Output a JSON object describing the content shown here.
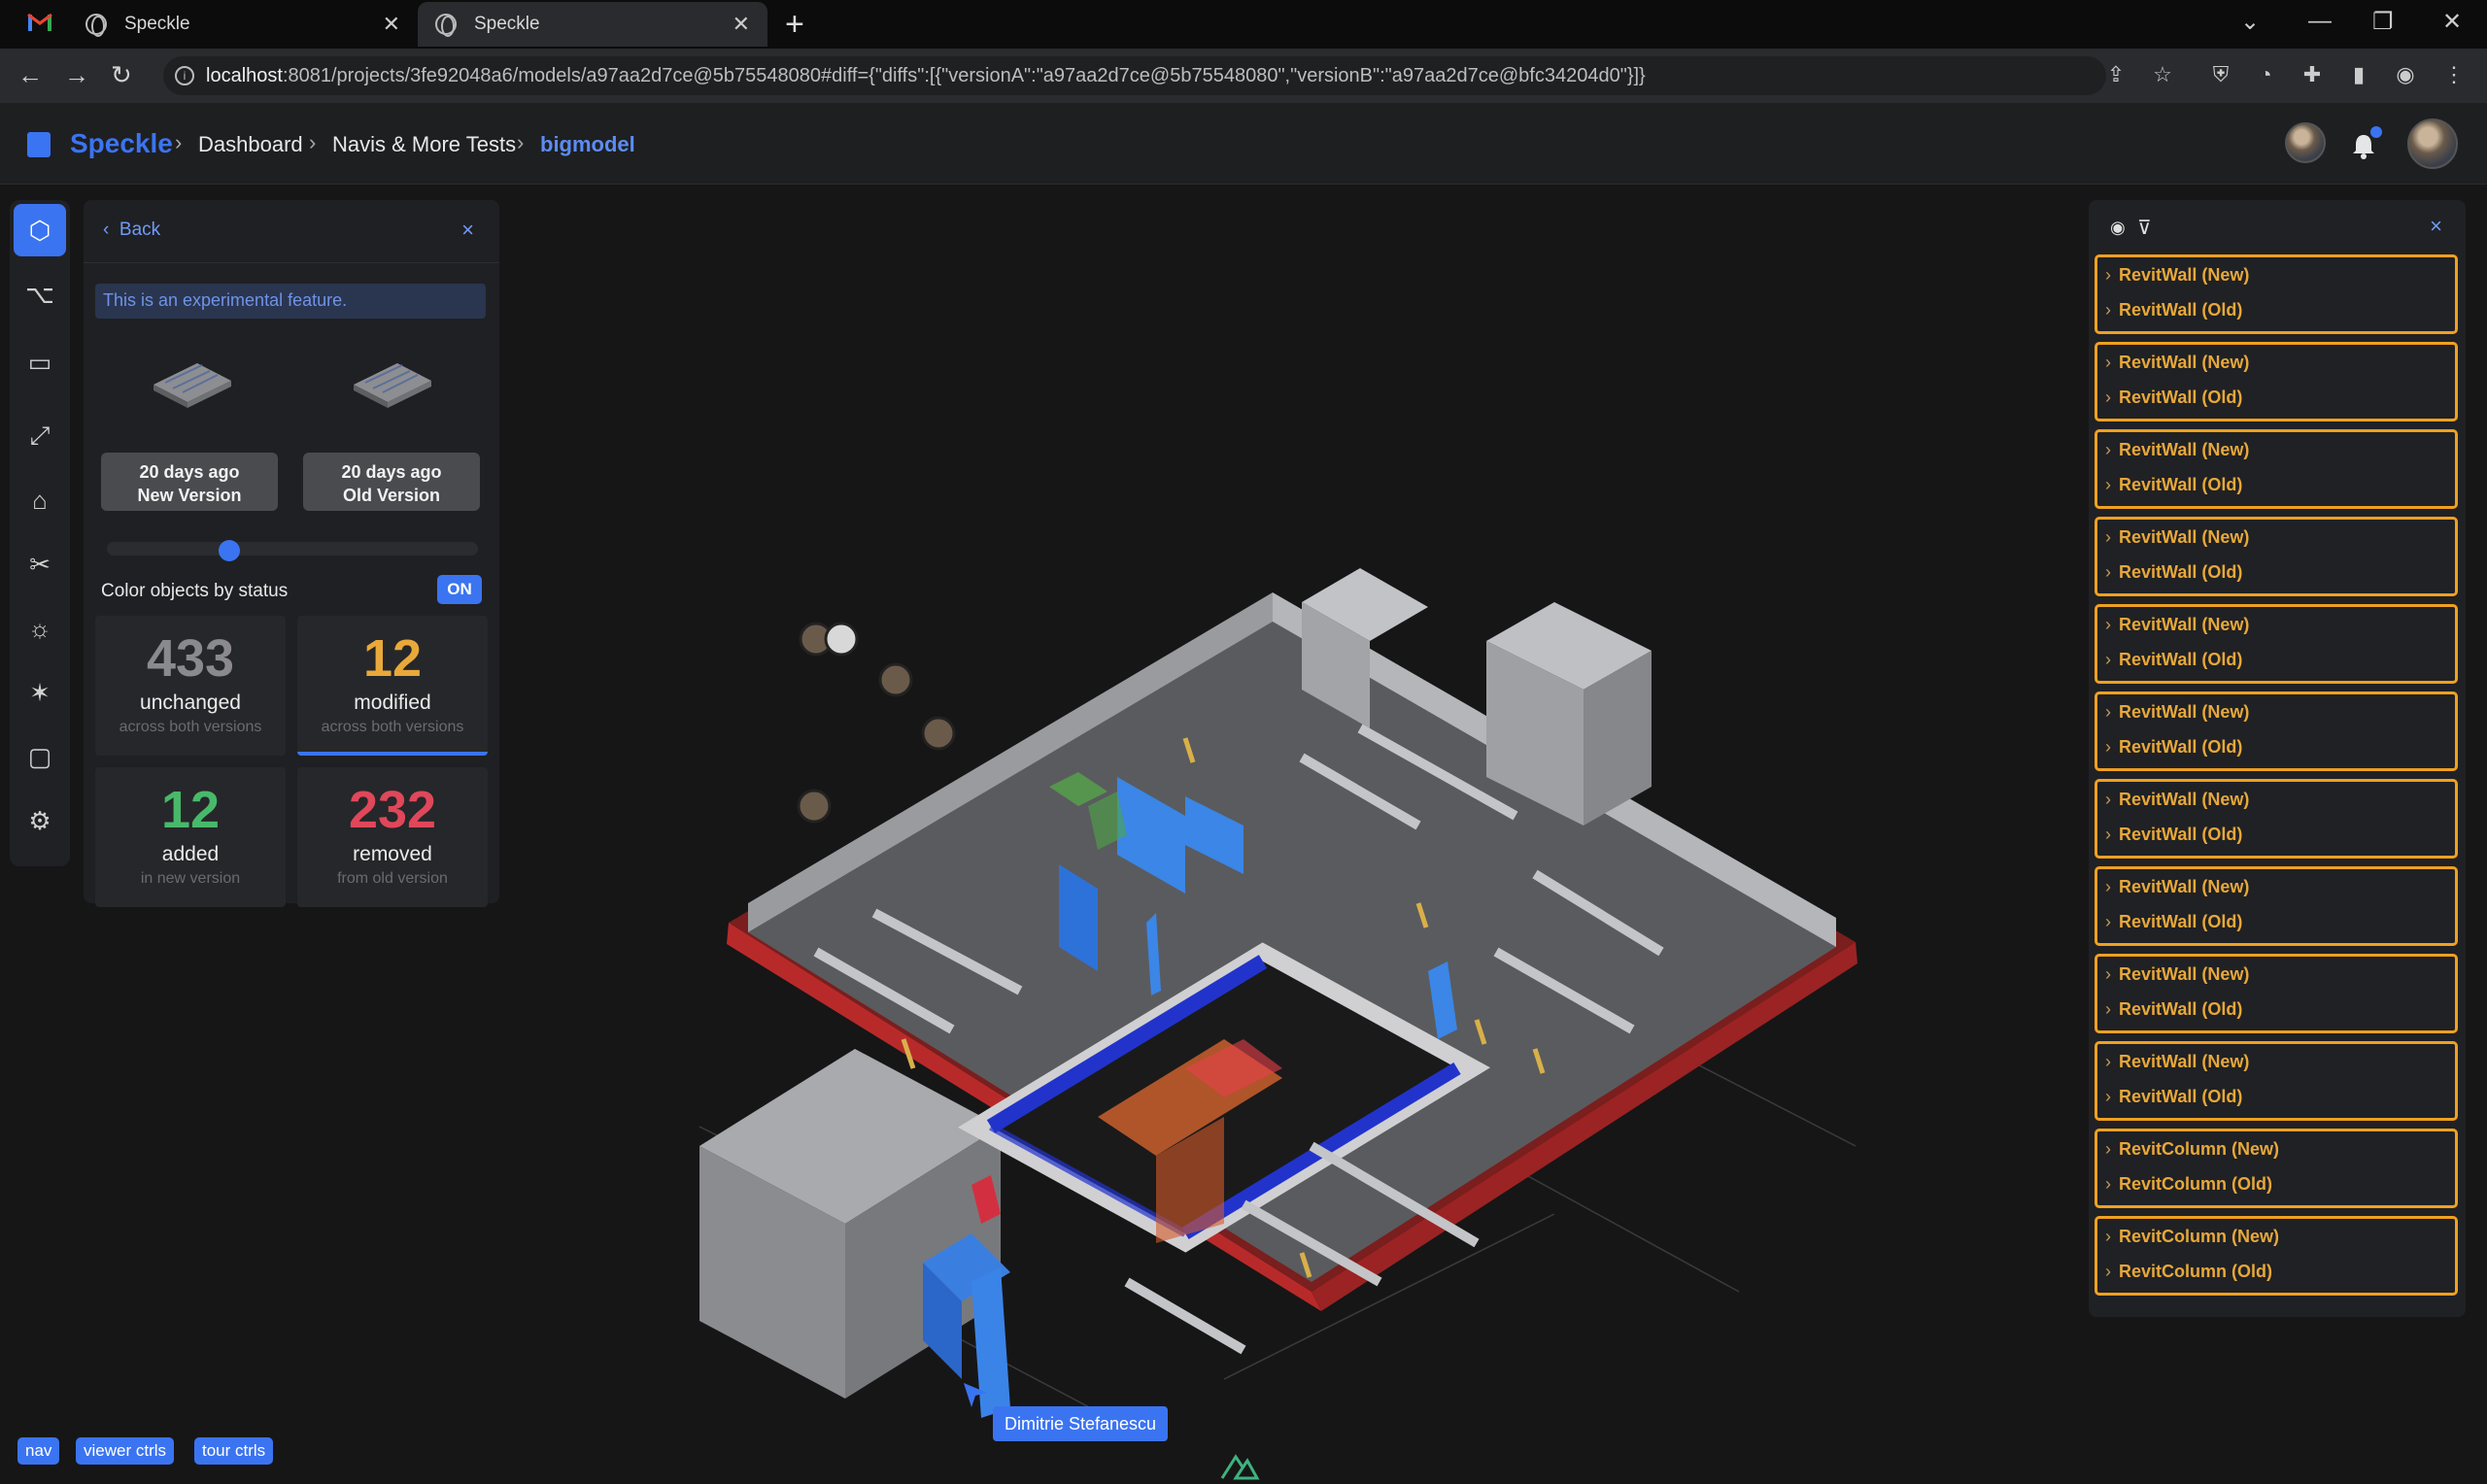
{
  "browser": {
    "tabs": [
      {
        "title": "Speckle",
        "active": false
      },
      {
        "title": "Speckle",
        "active": true
      }
    ],
    "url_host": "localhost",
    "url_rest": ":8081/projects/3fe92048a6/models/a97aa2d7ce@5b75548080#diff={\"diffs\":[{\"versionA\":\"a97aa2d7ce@5b75548080\",\"versionB\":\"a97aa2d7ce@bfc34204d0\"}]}",
    "new_tab_glyph": "+",
    "close_glyph": "✕"
  },
  "header": {
    "brand": "Speckle",
    "breadcrumbs": [
      "Dashboard",
      "Navis & More Tests",
      "bigmodel"
    ],
    "separator": "›",
    "notification_dot_color": "#3b74f1"
  },
  "rail": {
    "icons": [
      "cube-icon",
      "scene-tree-icon",
      "comments-icon",
      "zoom-extents-icon",
      "views-icon",
      "section-cut-icon",
      "light-icon",
      "explode-icon",
      "camera-icon",
      "settings-icon"
    ],
    "active_index": 0
  },
  "diff_panel": {
    "back_label": "Back",
    "notice": "This is an experimental feature.",
    "versions": [
      {
        "time": "20 days ago",
        "label": "New Version"
      },
      {
        "time": "20 days ago",
        "label": "Old Version"
      }
    ],
    "slider_value": 0.33,
    "color_by_status_label": "Color objects by status",
    "color_toggle": "ON",
    "stats": [
      {
        "value": "433",
        "label": "unchanged",
        "sub": "across both versions",
        "color": "#8a8a8e"
      },
      {
        "value": "12",
        "label": "modified",
        "sub": "across both versions",
        "color": "#e9a93a"
      },
      {
        "value": "12",
        "label": "added",
        "sub": "in new version",
        "color": "#48b96a"
      },
      {
        "value": "232",
        "label": "removed",
        "sub": "from old version",
        "color": "#e0475a"
      }
    ]
  },
  "viewer": {
    "cursor_user": "Dimitrie Stefanescu",
    "debug_buttons": [
      "nav",
      "viewer ctrls",
      "tour ctrls"
    ]
  },
  "diff_list": {
    "groups": [
      {
        "new": "RevitWall (New)",
        "old": "RevitWall (Old)"
      },
      {
        "new": "RevitWall (New)",
        "old": "RevitWall (Old)"
      },
      {
        "new": "RevitWall (New)",
        "old": "RevitWall (Old)"
      },
      {
        "new": "RevitWall (New)",
        "old": "RevitWall (Old)"
      },
      {
        "new": "RevitWall (New)",
        "old": "RevitWall (Old)"
      },
      {
        "new": "RevitWall (New)",
        "old": "RevitWall (Old)"
      },
      {
        "new": "RevitWall (New)",
        "old": "RevitWall (Old)"
      },
      {
        "new": "RevitWall (New)",
        "old": "RevitWall (Old)"
      },
      {
        "new": "RevitWall (New)",
        "old": "RevitWall (Old)"
      },
      {
        "new": "RevitWall (New)",
        "old": "RevitWall (Old)"
      },
      {
        "new": "RevitColumn (New)",
        "old": "RevitColumn (Old)"
      },
      {
        "new": "RevitColumn (New)",
        "old": "RevitColumn (Old)"
      }
    ],
    "accent_color": "#f0a020"
  }
}
